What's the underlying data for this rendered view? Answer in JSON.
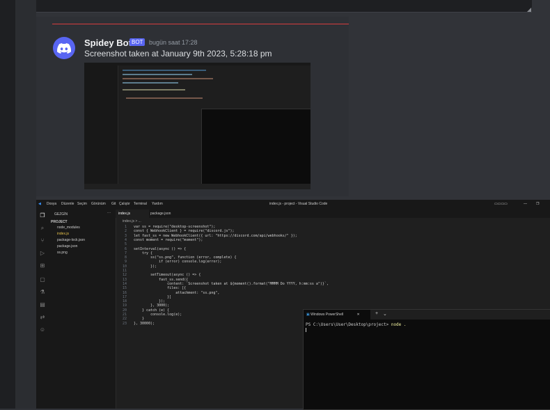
{
  "message": {
    "username": "Spidey Bot",
    "badge": "BOT",
    "timestamp": "bugün saat 17:28",
    "text": "Screenshot taken at January 9th 2023, 5:28:18 pm"
  },
  "vscode": {
    "menu": [
      "Dosya",
      "Düzenle",
      "Seçim",
      "Görünüm",
      "Git",
      "Çalıştır",
      "Terminal",
      "Yardım"
    ],
    "title": "index.js - project - Visual Studio Code",
    "explorer_label": "GEZGİN",
    "project_label": "PROJECT",
    "files": [
      "node_modules",
      "index.js",
      "package-lock.json",
      "package.json",
      "ss.png"
    ],
    "tabs": [
      "index.js",
      "package.json"
    ],
    "breadcrumb": "index.js > ...",
    "code_lines": [
      "var ss = require(\"desktop-screenshot\");",
      "const { WebhookClient } = require(\"discord.js\");",
      "let fast_ss = new WebhookClient({ url: \"https://discord.com/api/webhooks/\" });",
      "const moment = require(\"moment\");",
      "",
      "setInterval(async () => {",
      "    try {",
      "        ss(\"ss.png\", function (error, complete) {",
      "            if (error) console.log(error);",
      "        });",
      "",
      "        setTimeout(async () => {",
      "            fast_ss.send({",
      "                content: `Screenshot taken at ${moment().format(\"MMMM Do YYYY, h:mm:ss a\")}`,",
      "                files: [{",
      "                    attachment: \"ss.png\",",
      "                }]",
      "            });",
      "        }, 3000);",
      "    } catch (e) {",
      "        console.log(e);",
      "    }",
      "}, 30000);"
    ]
  },
  "powershell": {
    "tab_title": "Windows PowerShell",
    "prompt": "PS C:\\Users\\User\\Desktop\\project> ",
    "command": "node ."
  },
  "colors": {
    "accent": "#5865f2",
    "bg": "#313338",
    "divider": "#d83c3e"
  }
}
